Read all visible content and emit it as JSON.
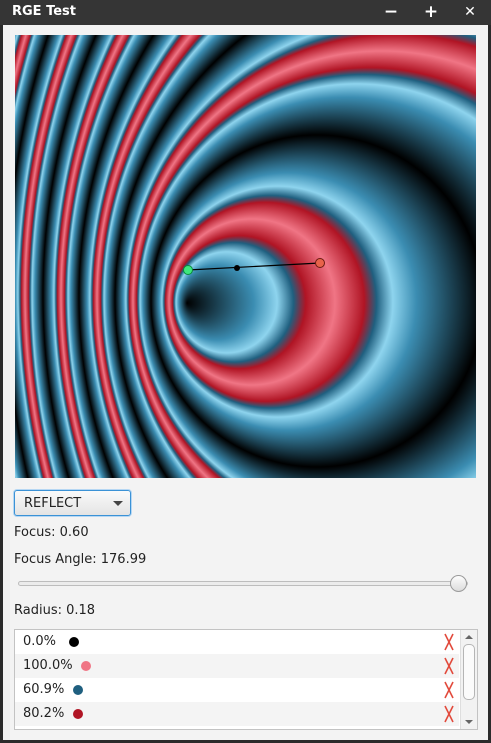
{
  "window": {
    "title": "RGE Test",
    "minimize_icon": "minimize-icon",
    "maximize_icon": "maximize-icon",
    "close_icon": "close-icon",
    "minimize_glyph": "−",
    "maximize_glyph": "+",
    "close_glyph": "✕"
  },
  "gradient_preview": {
    "cycle_method": "REFLECT",
    "colors": {
      "stop_0": "#000000",
      "stop_100": "#f07585",
      "stop_60_9": "#1f5f7f",
      "stop_80_2": "#b01424",
      "peak_light": "#8ed4ee",
      "handle_focus": "#3de87e",
      "handle_radius": "#e8634a"
    }
  },
  "controls": {
    "cycle_select": {
      "value": "REFLECT"
    },
    "focus_label": "Focus: 0.60",
    "focus_angle_label": "Focus Angle: 176.99",
    "focus_angle_slider": {
      "min": 0,
      "max": 180,
      "value": 176.99
    },
    "radius_label": "Radius: 0.18"
  },
  "stops": [
    {
      "label": "0.0%",
      "color": "#000000",
      "delete_icon": "x-delete-icon"
    },
    {
      "label": "100.0%",
      "color": "#f07585",
      "delete_icon": "x-delete-icon"
    },
    {
      "label": "60.9%",
      "color": "#1f5f7f",
      "delete_icon": "x-delete-icon"
    },
    {
      "label": "80.2%",
      "color": "#b01424",
      "delete_icon": "x-delete-icon"
    }
  ]
}
